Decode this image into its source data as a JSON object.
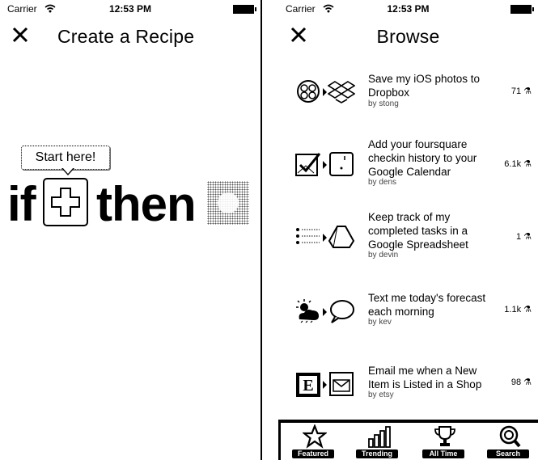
{
  "left_screen": {
    "status": {
      "carrier": "Carrier",
      "time": "12:53 PM"
    },
    "nav": {
      "title": "Create a Recipe",
      "close_icon": "close-icon"
    },
    "tooltip": "Start here!",
    "if_word": "if",
    "then_word": "then",
    "plus_icon": "plus-icon"
  },
  "right_screen": {
    "status": {
      "carrier": "Carrier",
      "time": "12:53 PM"
    },
    "nav": {
      "title": "Browse",
      "close_icon": "close-icon"
    },
    "recipes": [
      {
        "title": "Save my iOS photos to Dropbox",
        "author": "by stong",
        "count": "71 ⚗",
        "trigger_icon": "photos-icon",
        "action_icon": "dropbox-icon"
      },
      {
        "title": "Add your foursquare checkin history to your Google Calendar",
        "author": "by dens",
        "count": "6.1k ⚗",
        "trigger_icon": "foursquare-icon",
        "action_icon": "google-calendar-icon"
      },
      {
        "title": "Keep track of my completed tasks in a Google Spreadsheet",
        "author": "by devin",
        "count": "1 ⚗",
        "trigger_icon": "reminders-icon",
        "action_icon": "google-drive-icon"
      },
      {
        "title": "Text me today's forecast each morning",
        "author": "by kev",
        "count": "1.1k ⚗",
        "trigger_icon": "weather-icon",
        "action_icon": "sms-icon"
      },
      {
        "title": "Email me when a New Item is Listed in a Shop",
        "author": "by etsy",
        "count": "98 ⚗",
        "trigger_icon": "etsy-icon",
        "action_icon": "email-icon"
      }
    ],
    "tabs": [
      {
        "label": "Featured",
        "icon": "star-icon"
      },
      {
        "label": "Trending",
        "icon": "trending-icon"
      },
      {
        "label": "All Time",
        "icon": "trophy-icon"
      },
      {
        "label": "Search",
        "icon": "search-icon"
      }
    ]
  }
}
